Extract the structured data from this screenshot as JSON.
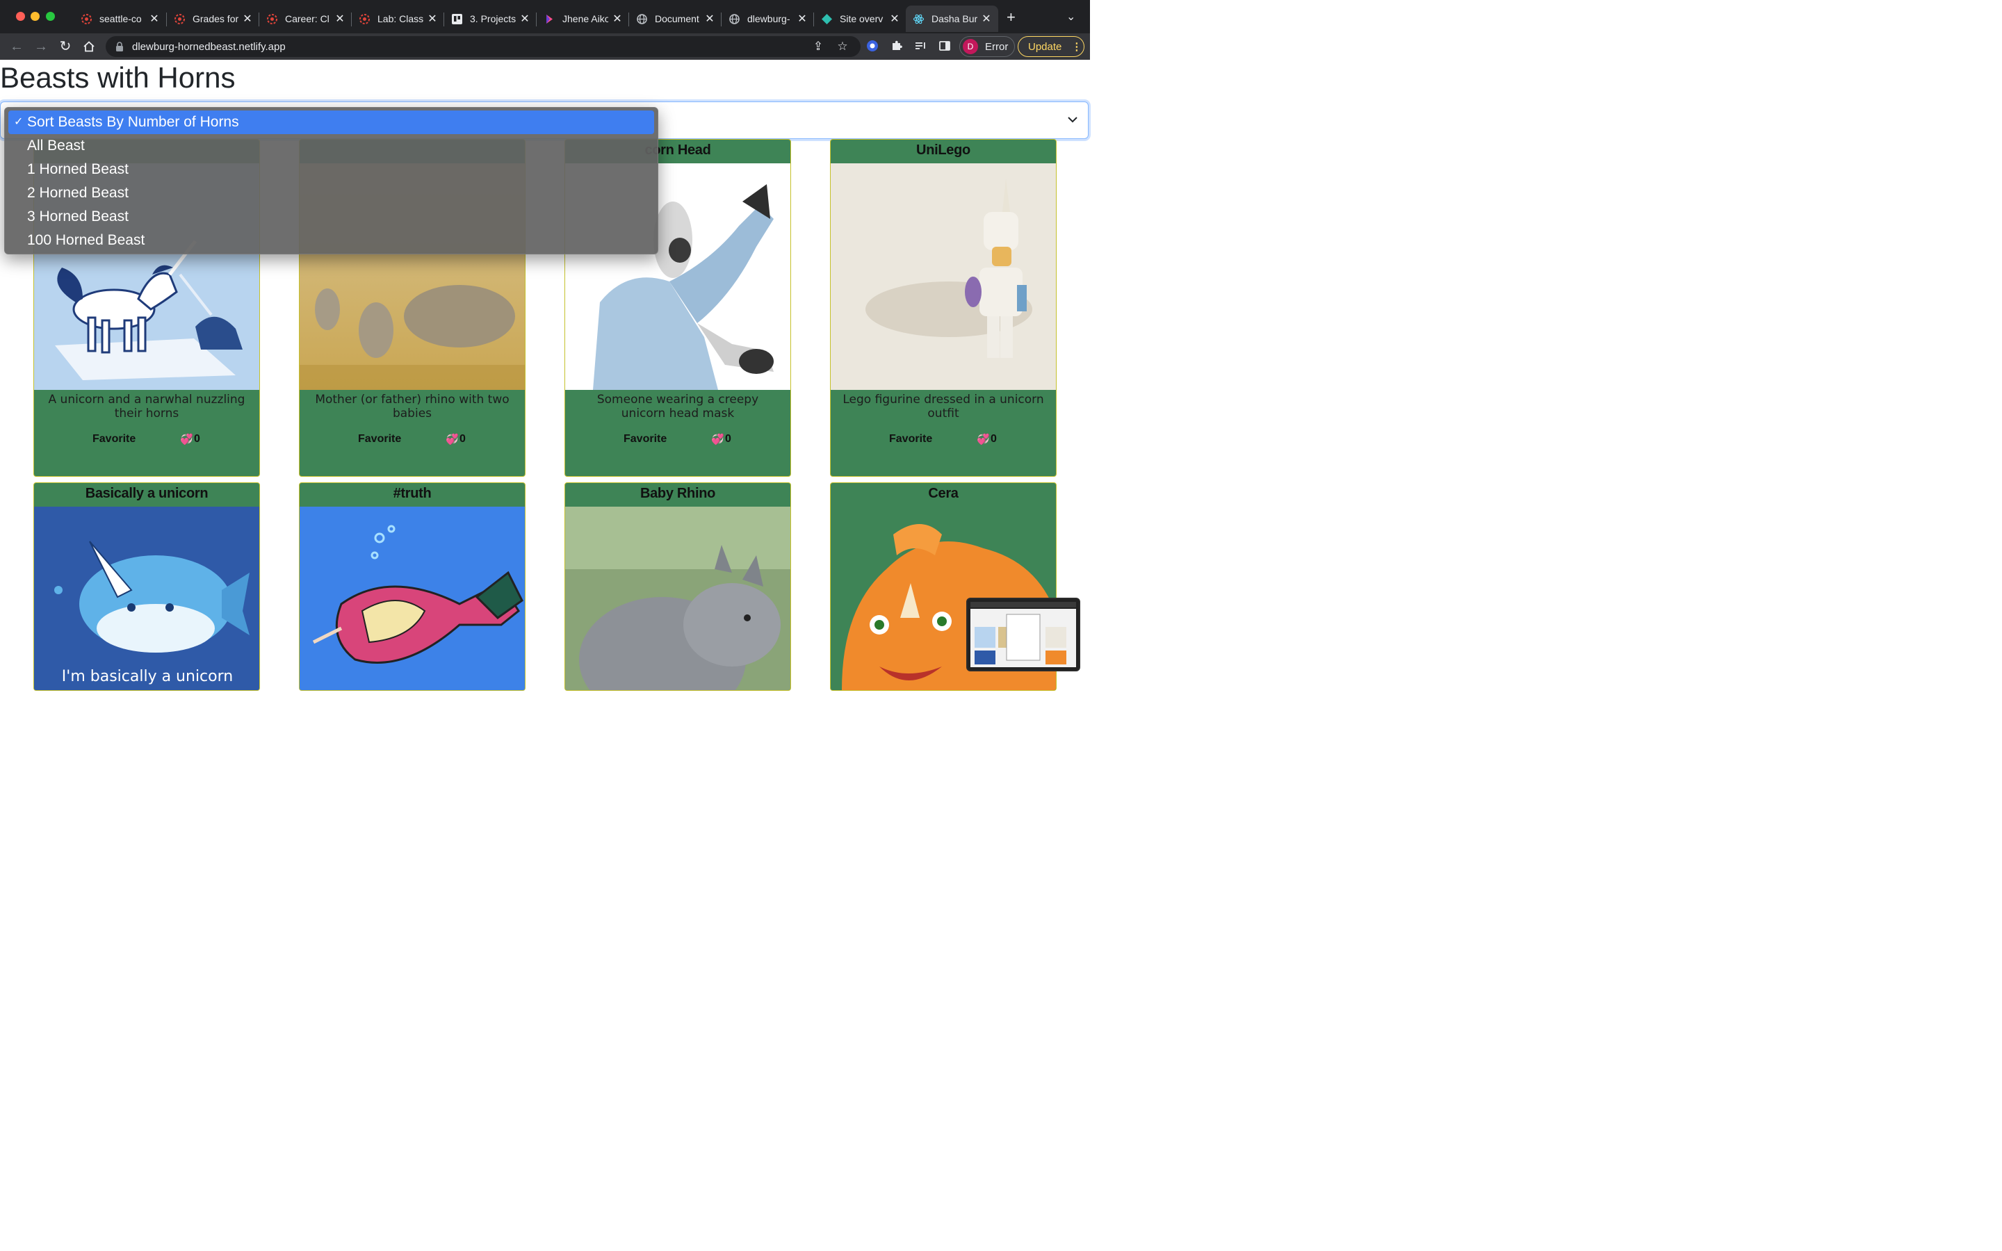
{
  "browser": {
    "tabs": [
      {
        "title": "seattle-co",
        "icon": "code-fellows-icon"
      },
      {
        "title": "Grades for",
        "icon": "code-fellows-icon"
      },
      {
        "title": "Career: Cl",
        "icon": "code-fellows-icon"
      },
      {
        "title": "Lab: Class",
        "icon": "code-fellows-icon"
      },
      {
        "title": "3. Projects",
        "icon": "trello-icon"
      },
      {
        "title": "Jhene Aiko",
        "icon": "music-icon"
      },
      {
        "title": "Document",
        "icon": "globe-icon"
      },
      {
        "title": "dlewburg-",
        "icon": "globe-icon"
      },
      {
        "title": "Site overv",
        "icon": "netlify-icon"
      },
      {
        "title": "Dasha Bur",
        "icon": "react-icon",
        "active": true
      }
    ],
    "url": "dlewburg-hornedbeast.netlify.app",
    "profile_initial": "D",
    "profile_status": "Error",
    "update_label": "Update"
  },
  "page": {
    "title": "Beasts with Horns",
    "select": {
      "options": [
        "Sort Beasts By Number of Horns",
        "All Beast",
        "1 Horned Beast",
        "2 Horned Beast",
        "3 Horned Beast",
        "100 Horned Beast"
      ],
      "selected": "Sort Beasts By Number of Horns"
    },
    "cards": [
      {
        "title": "",
        "description": "A unicorn and a narwhal nuzzling their horns",
        "favorite_label": "Favorite",
        "likes": "0"
      },
      {
        "title": "",
        "description": "Mother (or father) rhino with two babies",
        "favorite_label": "Favorite",
        "likes": "0"
      },
      {
        "title": "corn Head",
        "description": "Someone wearing a creepy unicorn head mask",
        "favorite_label": "Favorite",
        "likes": "0"
      },
      {
        "title": "UniLego",
        "description": "Lego figurine dressed in a unicorn outfit",
        "favorite_label": "Favorite",
        "likes": "0"
      },
      {
        "title": "Basically a unicorn",
        "image_caption": "I'm basically a unicorn"
      },
      {
        "title": "#truth"
      },
      {
        "title": "Baby Rhino"
      },
      {
        "title": "Cera"
      }
    ]
  },
  "colors": {
    "card_bg": "#3e8456",
    "card_border": "#c5c12c",
    "dropdown_highlight": "#3f7ef0"
  }
}
